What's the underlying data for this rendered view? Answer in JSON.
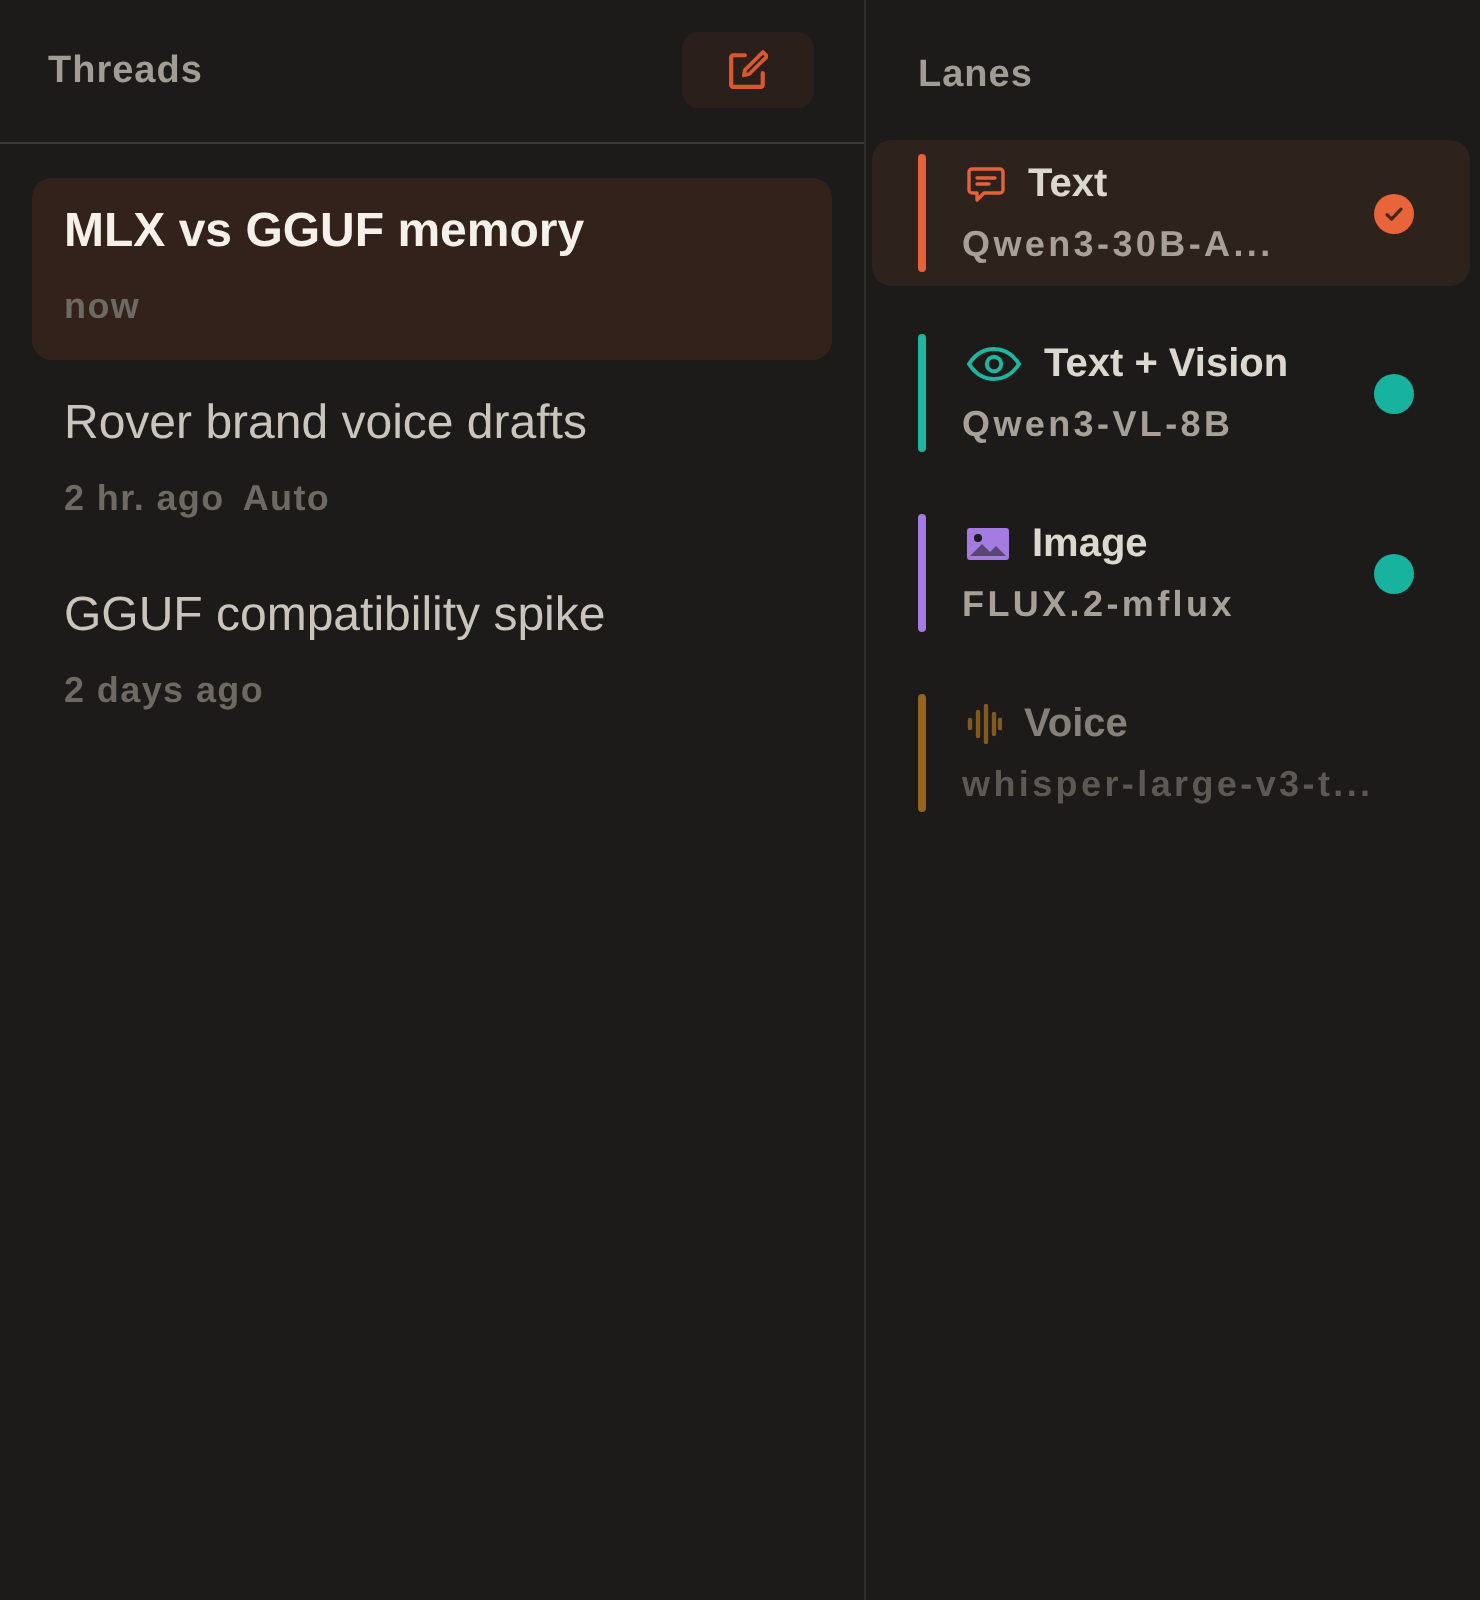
{
  "threads_panel": {
    "title": "Threads",
    "threads": [
      {
        "title": "MLX vs GGUF memory",
        "time": "now",
        "selected": true
      },
      {
        "title": "Rover brand voice drafts",
        "time": "2 hr. ago",
        "tag": "Auto",
        "selected": false
      },
      {
        "title": "GGUF compatibility spike",
        "time": "2 days ago",
        "selected": false
      }
    ]
  },
  "lanes_panel": {
    "title": "Lanes",
    "lanes": [
      {
        "kind": "chat",
        "name": "Text",
        "model": "Qwen3-30B-A...",
        "color": "#e5623a",
        "selected": true,
        "disabled": false,
        "loaded": true
      },
      {
        "kind": "vision",
        "name": "Text + Vision",
        "model": "Qwen3-VL-8B",
        "color": "#1fb5a0",
        "selected": false,
        "disabled": false,
        "loaded": true
      },
      {
        "kind": "image",
        "name": "Image",
        "model": "FLUX.2-mflux",
        "color": "#a47be0",
        "selected": false,
        "disabled": false,
        "loaded": true
      },
      {
        "kind": "voice",
        "name": "Voice",
        "model": "whisper-large-v3-t...",
        "color": "#946420",
        "selected": false,
        "disabled": true,
        "loaded": false
      }
    ]
  }
}
